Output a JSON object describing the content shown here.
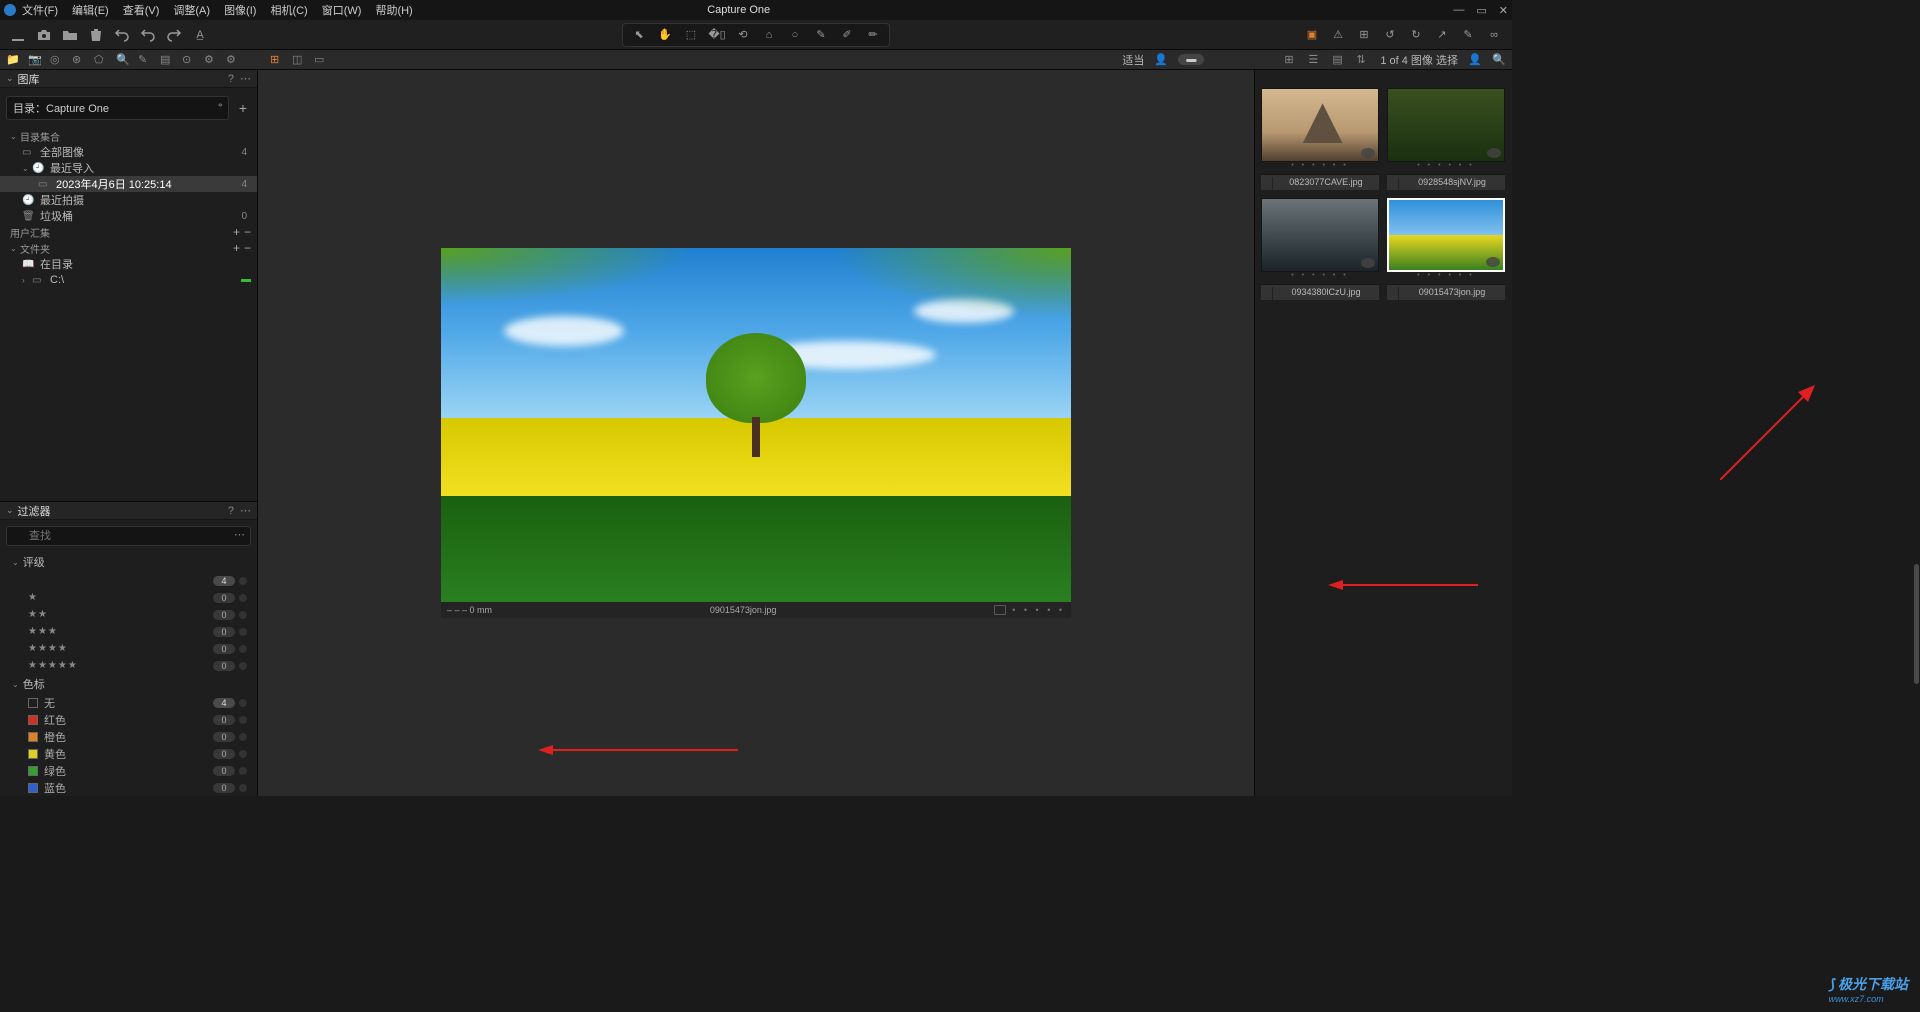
{
  "app": {
    "title": "Capture One"
  },
  "menu": [
    "文件(F)",
    "编辑(E)",
    "查看(V)",
    "调整(A)",
    "图像(I)",
    "相机(C)",
    "窗口(W)",
    "帮助(H)"
  ],
  "tabstrip_right": {
    "fit_label": "适当",
    "status": "1 of 4 图像 选择"
  },
  "library": {
    "panel_title": "图库",
    "catalog_label": "目录：Capture One",
    "groups": {
      "collection": "目录集合",
      "all_images": {
        "label": "全部图像",
        "count": "4"
      },
      "recent_import": "最近导入",
      "import_session": {
        "label": "2023年4月6日 10:25:14",
        "count": "4"
      },
      "recent_capture": "最近拍摄",
      "trash": {
        "label": "垃圾桶",
        "count": "0"
      },
      "user_coll": "用户汇集",
      "folders": "文件夹",
      "in_catalog": "在目录",
      "drive": "C:\\"
    }
  },
  "filter": {
    "panel_title": "过滤器",
    "search_placeholder": "查找",
    "rating_header": "评级",
    "ratings": [
      {
        "stars": "",
        "count": "4"
      },
      {
        "stars": "★",
        "count": "0"
      },
      {
        "stars": "★★",
        "count": "0"
      },
      {
        "stars": "★★★",
        "count": "0"
      },
      {
        "stars": "★★★★",
        "count": "0"
      },
      {
        "stars": "★★★★★",
        "count": "0"
      }
    ],
    "color_header": "色标",
    "colors": [
      {
        "label": "无",
        "hex": "transparent",
        "count": "4"
      },
      {
        "label": "红色",
        "hex": "#d03020",
        "count": "0"
      },
      {
        "label": "橙色",
        "hex": "#e08020",
        "count": "0"
      },
      {
        "label": "黄色",
        "hex": "#e0d020",
        "count": "0"
      },
      {
        "label": "绿色",
        "hex": "#30a030",
        "count": "0"
      },
      {
        "label": "蓝色",
        "hex": "#3060d0",
        "count": "0"
      }
    ]
  },
  "viewer": {
    "caption_left": "– – –  0 mm",
    "filename": "09015473jon.jpg"
  },
  "browser": {
    "thumbs": [
      {
        "name": "0823077CAVE.jpg",
        "scene": "mountain",
        "selected": false
      },
      {
        "name": "0928548sjNV.jpg",
        "scene": "forest",
        "selected": false
      },
      {
        "name": "0934380lCzU.jpg",
        "scene": "lake",
        "selected": false
      },
      {
        "name": "09015473jon.jpg",
        "scene": "field",
        "selected": true
      }
    ]
  },
  "watermark": {
    "line1": "极光下载站",
    "line2": "www.xz7.com"
  }
}
